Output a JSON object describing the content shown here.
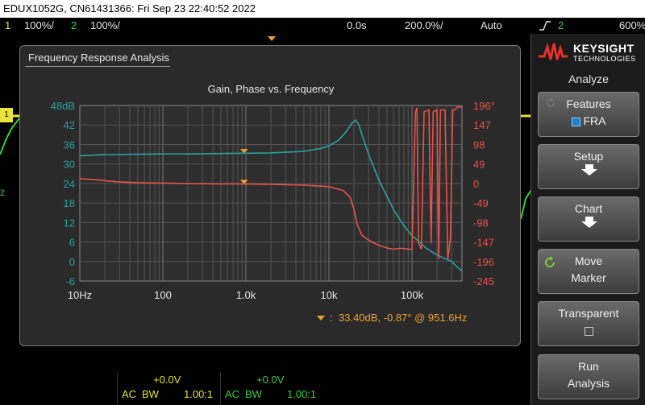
{
  "title_bar": "EDUX1052G, CN61431366: Fri Sep 23 22:40:52 2022",
  "status": {
    "ch1_num": "1",
    "ch1_scale": "100%/",
    "ch2_num": "2",
    "ch2_scale": "100%/",
    "time_delay": "0.0s",
    "time_scale": "200.0%/",
    "trigger_mode": "Auto",
    "trigger_slope_icon": "rising-edge-icon",
    "trigger_source": "2",
    "trigger_level": "600%"
  },
  "fra_window": {
    "title": "Frequency Response Analysis",
    "marker_readout": "33.40dB, -0.87° @ 951.6Hz",
    "marker_prefix": ":"
  },
  "chart_data": {
    "type": "line",
    "title": "Gain, Phase vs. Frequency",
    "x_scale": "log",
    "x_ticks": [
      "10Hz",
      "100",
      "1.0k",
      "10k",
      "100k"
    ],
    "x_range_hz": [
      10,
      400000
    ],
    "y_left_ticks": [
      "48dB",
      "42",
      "36",
      "30",
      "24",
      "18",
      "12",
      "6",
      "0",
      "-6"
    ],
    "y_left_range": [
      -6,
      48
    ],
    "y_right_ticks": [
      "196°",
      "147",
      "98",
      "49",
      "0",
      "-49",
      "-98",
      "-147",
      "-196",
      "-245"
    ],
    "y_right_range": [
      -245,
      196
    ],
    "grid": true,
    "colors": {
      "gain": "#2aa0a0",
      "phase": "#e8524a",
      "marker": "#f0a030",
      "axis_left": "#2aa0a0",
      "axis_right": "#e8524a"
    },
    "series": [
      {
        "key": "gain",
        "x": [
          10,
          20,
          50,
          100,
          200,
          500,
          1000,
          2000,
          5000,
          8000,
          10000,
          13000,
          16000,
          19000,
          21000,
          23000,
          25000,
          30000,
          40000,
          60000,
          80000,
          100000,
          150000,
          200000,
          300000,
          400000
        ],
        "values": [
          32.5,
          32.9,
          33.0,
          33.1,
          33.1,
          33.2,
          33.3,
          33.4,
          33.9,
          34.8,
          35.6,
          37.3,
          39.8,
          42.6,
          43.5,
          42.0,
          39.0,
          33.0,
          25.0,
          16.0,
          11.0,
          8.0,
          4.0,
          2.0,
          0.0,
          -3.0
        ]
      },
      {
        "key": "phase",
        "x": [
          10,
          15,
          20,
          30,
          50,
          100,
          200,
          500,
          1000,
          2000,
          5000,
          10000,
          15000,
          18000,
          20000,
          22000,
          25000,
          30000,
          35000,
          40000,
          50000,
          60000,
          70000,
          80000,
          90000,
          100000,
          110000,
          115000,
          120000,
          130000,
          140000,
          160000,
          170000,
          180000,
          200000,
          210000,
          220000,
          250000,
          270000,
          290000,
          310000,
          330000,
          350000,
          380000,
          400000
        ],
        "values": [
          12,
          10,
          7,
          4,
          2,
          1,
          0,
          -1,
          -1,
          -2,
          -4,
          -8,
          -18,
          -35,
          -65,
          -105,
          -130,
          -142,
          -150,
          -155,
          -162,
          -165,
          -163,
          -163,
          -165,
          -165,
          180,
          190,
          -150,
          -165,
          180,
          185,
          -150,
          180,
          185,
          -190,
          185,
          185,
          -190,
          -140,
          185,
          185,
          192,
          192,
          192
        ]
      }
    ],
    "markers": [
      {
        "series": "gain",
        "x": 951.6,
        "value": 33.4
      },
      {
        "series": "phase",
        "x": 951.6,
        "value": -0.87
      }
    ]
  },
  "bottom": {
    "ch1_offset": "+0.0V",
    "ch1_coupling": "AC",
    "ch1_bw": "BW",
    "ch1_probe": "1.00:1",
    "ch2_offset": "+0.0V",
    "ch2_coupling": "AC",
    "ch2_bw": "BW",
    "ch2_probe": "1.00:1"
  },
  "side_panel": {
    "brand": "KEYSIGHT",
    "brand_sub": "TECHNOLOGIES",
    "menu_title": "Analyze",
    "features_label": "Features",
    "features_value": "FRA",
    "features_checked": true,
    "setup_label": "Setup",
    "chart_label": "Chart",
    "move_marker_l1": "Move",
    "move_marker_l2": "Marker",
    "transparent_label": "Transparent",
    "transparent_checked": false,
    "run_l1": "Run",
    "run_l2": "Analysis"
  }
}
